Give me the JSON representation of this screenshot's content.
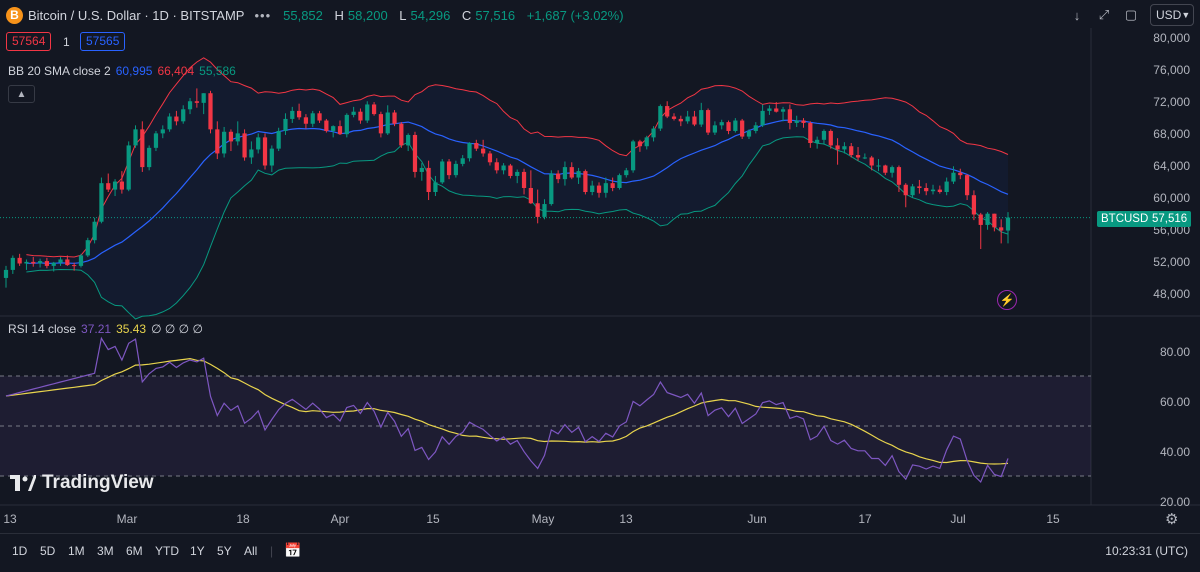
{
  "header": {
    "coin_icon": "B",
    "symbol": "Bitcoin / U.S. Dollar · 1D · BITSTAMP",
    "more_icon": "more-dots-icon",
    "ohlc": [
      {
        "k": "",
        "v": "55,852"
      },
      {
        "k": "H",
        "v": "58,200"
      },
      {
        "k": "L",
        "v": "54,296"
      },
      {
        "k": "C",
        "v": "57,516"
      }
    ],
    "change": "+1,687 (+3.02%)"
  },
  "trade": {
    "sell": "57564",
    "qty": "1",
    "buy": "57565"
  },
  "bb": {
    "label": "BB 20 SMA close 2",
    "mid": "60,995",
    "upper": "66,404",
    "lower": "55,586"
  },
  "rsi": {
    "label": "RSI 14 close",
    "value": "37.21",
    "ma": "35.43",
    "extra": "∅ ∅ ∅ ∅"
  },
  "currency": "USD",
  "price_axis": [
    "80,000",
    "76,000",
    "72,000",
    "68,000",
    "64,000",
    "60,000",
    "56,000",
    "52,000",
    "48,000"
  ],
  "rsi_axis": [
    "80.00",
    "60.00",
    "40.00",
    "20.00"
  ],
  "last_price_tag": {
    "symbol": "BTCUSD",
    "price": "57,516"
  },
  "time_axis": [
    "13",
    "Mar",
    "18",
    "Apr",
    "15",
    "May",
    "13",
    "Jun",
    "17",
    "Jul",
    "15"
  ],
  "ranges": [
    "1D",
    "5D",
    "1M",
    "3M",
    "6M",
    "YTD",
    "1Y",
    "5Y",
    "All"
  ],
  "clock": "10:23:31 (UTC)",
  "logo_text": "TradingView",
  "colors": {
    "up": "#089981",
    "down": "#f23645",
    "bb_mid": "#2962ff",
    "bb_upper": "#f23645",
    "bb_lower": "#089981",
    "rsi": "#7e57c2",
    "rsi_ma": "#e8d44d",
    "bg": "#131722"
  },
  "chart_data": {
    "type": "candlestick",
    "series": [
      {
        "name": "BTCUSD",
        "ohlc": [
          [
            50000,
            51500,
            48800,
            51000
          ],
          [
            51000,
            52800,
            50500,
            52500
          ],
          [
            52500,
            53000,
            51500,
            51800
          ],
          [
            51800,
            52300,
            51000,
            52000
          ],
          [
            52000,
            52600,
            51400,
            51800
          ],
          [
            51800,
            52400,
            51300,
            52100
          ],
          [
            52100,
            52500,
            51200,
            51500
          ],
          [
            51500,
            52000,
            50800,
            51900
          ],
          [
            51900,
            52600,
            51500,
            52300
          ],
          [
            52300,
            52800,
            51500,
            51600
          ],
          [
            51600,
            51900,
            50900,
            51500
          ],
          [
            51500,
            53000,
            51300,
            52800
          ],
          [
            52800,
            55000,
            52600,
            54700
          ],
          [
            54700,
            57500,
            54300,
            57000
          ],
          [
            57000,
            62500,
            56800,
            61800
          ],
          [
            61800,
            63000,
            60700,
            61000
          ],
          [
            61000,
            62300,
            60200,
            62000
          ],
          [
            62000,
            63300,
            60500,
            61000
          ],
          [
            61000,
            67000,
            60800,
            66500
          ],
          [
            66500,
            69000,
            66200,
            68500
          ],
          [
            68500,
            69500,
            63200,
            63800
          ],
          [
            63800,
            66500,
            63400,
            66200
          ],
          [
            66200,
            68300,
            65800,
            68000
          ],
          [
            68000,
            69000,
            67400,
            68500
          ],
          [
            68500,
            70500,
            68200,
            70100
          ],
          [
            70100,
            70800,
            69000,
            69500
          ],
          [
            69500,
            71500,
            69200,
            71000
          ],
          [
            71000,
            72400,
            70400,
            72000
          ],
          [
            72000,
            73600,
            71200,
            71800
          ],
          [
            71800,
            73000,
            70400,
            73000
          ],
          [
            73000,
            73300,
            68000,
            68500
          ],
          [
            68500,
            69500,
            64800,
            65500
          ],
          [
            65500,
            68800,
            65000,
            68200
          ],
          [
            68200,
            68500,
            65800,
            67000
          ],
          [
            67000,
            69500,
            66500,
            68000
          ],
          [
            68000,
            68500,
            64600,
            65000
          ],
          [
            65000,
            67000,
            64200,
            66000
          ],
          [
            66000,
            68000,
            65500,
            67500
          ],
          [
            67500,
            68000,
            63500,
            64000
          ],
          [
            64000,
            66500,
            63200,
            66100
          ],
          [
            66100,
            68700,
            65800,
            68300
          ],
          [
            68300,
            70500,
            67800,
            69800
          ],
          [
            69800,
            71300,
            69300,
            70800
          ],
          [
            70800,
            71700,
            69700,
            70000
          ],
          [
            70000,
            70400,
            68600,
            69200
          ],
          [
            69200,
            70800,
            68800,
            70500
          ],
          [
            70500,
            70800,
            69300,
            69600
          ],
          [
            69600,
            69800,
            68100,
            68300
          ],
          [
            68300,
            69000,
            67500,
            68900
          ],
          [
            68900,
            69600,
            67800,
            67900
          ],
          [
            67900,
            70500,
            67500,
            70300
          ],
          [
            70300,
            71300,
            70000,
            70700
          ],
          [
            70700,
            71100,
            69200,
            69600
          ],
          [
            69600,
            72000,
            69300,
            71600
          ],
          [
            71600,
            71900,
            70200,
            70400
          ],
          [
            70400,
            70700,
            67500,
            68000
          ],
          [
            68000,
            71500,
            67800,
            70600
          ],
          [
            70600,
            70900,
            68900,
            69200
          ],
          [
            69200,
            69400,
            66200,
            66500
          ],
          [
            66500,
            68000,
            65800,
            67800
          ],
          [
            67800,
            68200,
            62500,
            63200
          ],
          [
            63200,
            64300,
            62100,
            63700
          ],
          [
            63700,
            64600,
            59700,
            60700
          ],
          [
            60700,
            62700,
            60200,
            61900
          ],
          [
            61900,
            64800,
            61700,
            64500
          ],
          [
            64500,
            64800,
            62300,
            62800
          ],
          [
            62800,
            64600,
            62500,
            64200
          ],
          [
            64200,
            65300,
            63900,
            64900
          ],
          [
            64900,
            66900,
            64500,
            66800
          ],
          [
            66800,
            67200,
            65800,
            66100
          ],
          [
            66100,
            67200,
            65100,
            65500
          ],
          [
            65500,
            65800,
            64000,
            64400
          ],
          [
            64400,
            64900,
            63000,
            63400
          ],
          [
            63400,
            64300,
            62900,
            64000
          ],
          [
            64000,
            64200,
            62400,
            62700
          ],
          [
            62700,
            63500,
            61800,
            63200
          ],
          [
            63200,
            63600,
            60400,
            61200
          ],
          [
            61200,
            63400,
            59200,
            59300
          ],
          [
            59300,
            61000,
            56800,
            57600
          ],
          [
            57600,
            59800,
            57300,
            59200
          ],
          [
            59200,
            63400,
            59000,
            63000
          ],
          [
            63000,
            63400,
            61800,
            62300
          ],
          [
            62300,
            64500,
            61500,
            63800
          ],
          [
            63800,
            64400,
            62300,
            62500
          ],
          [
            62500,
            63700,
            61700,
            63300
          ],
          [
            63300,
            63500,
            60400,
            60700
          ],
          [
            60700,
            62100,
            60300,
            61500
          ],
          [
            61500,
            61900,
            60000,
            60600
          ],
          [
            60600,
            62500,
            60000,
            61800
          ],
          [
            61800,
            62500,
            60800,
            61200
          ],
          [
            61200,
            63000,
            61000,
            62800
          ],
          [
            62800,
            63700,
            62500,
            63400
          ],
          [
            63400,
            67200,
            63100,
            67000
          ],
          [
            67000,
            67200,
            65700,
            66400
          ],
          [
            66400,
            67700,
            66000,
            67500
          ],
          [
            67500,
            68900,
            67000,
            68600
          ],
          [
            68600,
            71600,
            68300,
            71400
          ],
          [
            71400,
            72000,
            69900,
            70100
          ],
          [
            70100,
            70500,
            69600,
            69800
          ],
          [
            69800,
            70200,
            68900,
            69500
          ],
          [
            69500,
            70800,
            69200,
            70100
          ],
          [
            70100,
            70800,
            68900,
            69100
          ],
          [
            69100,
            71800,
            68800,
            70900
          ],
          [
            70900,
            71100,
            67800,
            68100
          ],
          [
            68100,
            69500,
            67800,
            69000
          ],
          [
            69000,
            69700,
            68500,
            69400
          ],
          [
            69400,
            69600,
            67900,
            68300
          ],
          [
            68300,
            69900,
            68100,
            69600
          ],
          [
            69600,
            69800,
            67300,
            67600
          ],
          [
            67600,
            68500,
            67300,
            68300
          ],
          [
            68300,
            69400,
            68000,
            69000
          ],
          [
            69000,
            71600,
            68800,
            70800
          ],
          [
            70800,
            71500,
            70300,
            71100
          ],
          [
            71100,
            71900,
            70600,
            70700
          ],
          [
            70700,
            71300,
            69500,
            71000
          ],
          [
            71000,
            71600,
            68500,
            69300
          ],
          [
            69300,
            70200,
            68800,
            69600
          ],
          [
            69600,
            69900,
            68700,
            69300
          ],
          [
            69300,
            69500,
            66200,
            66800
          ],
          [
            66800,
            67600,
            66100,
            67200
          ],
          [
            67200,
            68500,
            66600,
            68300
          ],
          [
            68300,
            68500,
            66100,
            66500
          ],
          [
            66500,
            67400,
            64100,
            66000
          ],
          [
            66000,
            66900,
            65500,
            66400
          ],
          [
            66400,
            66800,
            65000,
            65300
          ],
          [
            65300,
            66300,
            64600,
            65000
          ],
          [
            65000,
            65500,
            64800,
            65000
          ],
          [
            65000,
            65200,
            63400,
            64000
          ],
          [
            64000,
            64800,
            63300,
            64000
          ],
          [
            64000,
            64100,
            62800,
            63100
          ],
          [
            63100,
            64000,
            62500,
            63800
          ],
          [
            63800,
            64000,
            60700,
            61600
          ],
          [
            61600,
            61800,
            58800,
            60300
          ],
          [
            60300,
            61700,
            60000,
            61400
          ],
          [
            61400,
            62200,
            60500,
            61200
          ],
          [
            61200,
            61800,
            60300,
            60800
          ],
          [
            60800,
            61600,
            60400,
            61000
          ],
          [
            61000,
            61500,
            60500,
            60700
          ],
          [
            60700,
            62500,
            60300,
            62000
          ],
          [
            62000,
            63900,
            61700,
            63100
          ],
          [
            63100,
            63600,
            62300,
            62800
          ],
          [
            62800,
            62900,
            59700,
            60300
          ],
          [
            60300,
            60900,
            57200,
            57900
          ],
          [
            57900,
            58100,
            53600,
            56600
          ],
          [
            56600,
            58200,
            56000,
            58000
          ],
          [
            58000,
            58000,
            55800,
            56300
          ],
          [
            56300,
            57300,
            54300,
            55900
          ],
          [
            55900,
            58200,
            54300,
            57516
          ]
        ]
      },
      {
        "name": "BB 20 SMA close 2"
      },
      {
        "name": "RSI 14 close"
      }
    ],
    "yaxis": {
      "min": 46000,
      "max": 81000,
      "ticks": [
        48000,
        52000,
        56000,
        60000,
        64000,
        68000,
        72000,
        76000,
        80000
      ]
    },
    "rsi_axis": {
      "min": 20,
      "max": 88,
      "bands": [
        30,
        50,
        70
      ],
      "ticks": [
        20,
        40,
        60,
        80
      ]
    },
    "xaxis_ticks": [
      "13",
      "Mar",
      "18",
      "Apr",
      "15",
      "May",
      "13",
      "Jun",
      "17",
      "Jul",
      "15"
    ],
    "grid": false
  }
}
